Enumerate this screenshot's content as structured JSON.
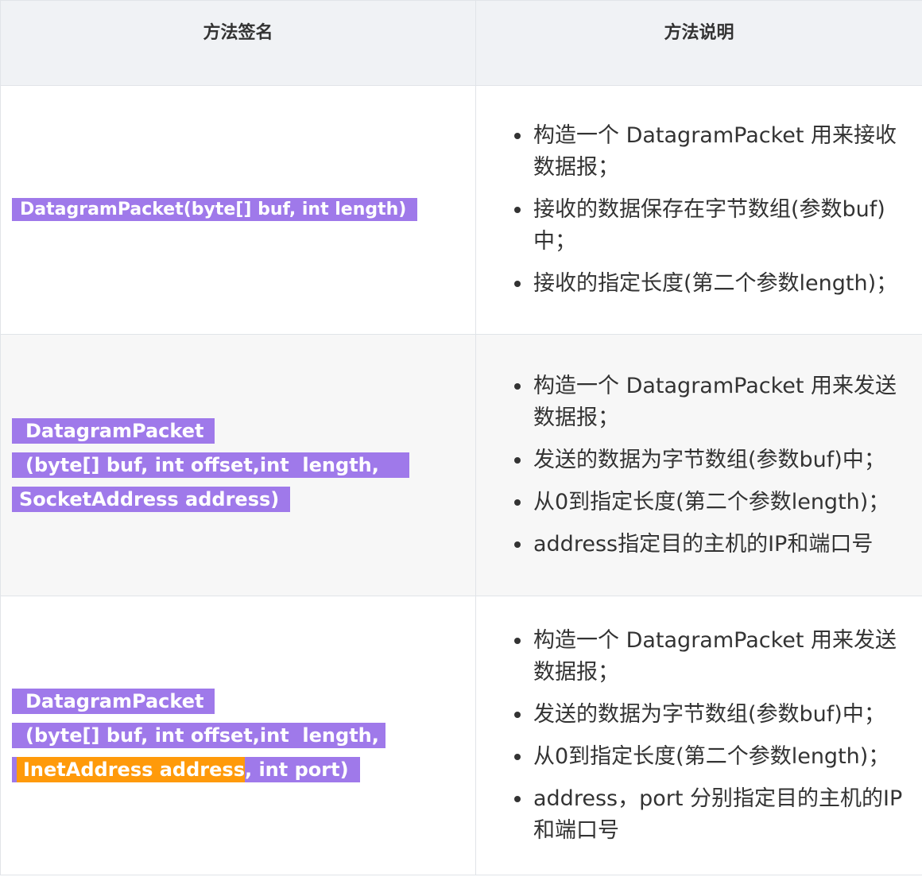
{
  "header": {
    "col1": "方法签名",
    "col2": "方法说明"
  },
  "rows": [
    {
      "signature": [
        "DatagramPacket(byte[] buf, int length)"
      ],
      "desc": [
        "构造一个 DatagramPacket 用来接收数据报；",
        "接收的数据保存在字节数组(参数buf)中；",
        "接收的指定长度(第二个参数length)；"
      ]
    },
    {
      "signature": [
        "DatagramPacket",
        "(byte[] buf, int offset,int  length,",
        "SocketAddress address)"
      ],
      "desc": [
        "构造一个 DatagramPacket 用来发送数据报；",
        "发送的数据为字节数组(参数buf)中；",
        "从0到指定长度(第二个参数length)；",
        "address指定目的主机的IP和端口号"
      ]
    },
    {
      "signature": [
        "DatagramPacket",
        "(byte[] buf, int offset,int  length,"
      ],
      "signature_last_highlight": "InetAddress address",
      "signature_last_rest": ", int port)",
      "desc": [
        "构造一个 DatagramPacket 用来发送数据报；",
        "发送的数据为字节数组(参数buf)中；",
        "从0到指定长度(第二个参数length)；",
        "address，port 分别指定目的主机的IP和端口号"
      ]
    }
  ],
  "colors": {
    "highlight_purple": "#9f79ea",
    "highlight_orange": "#ff9a0a",
    "header_bg": "#f0f2f5"
  }
}
